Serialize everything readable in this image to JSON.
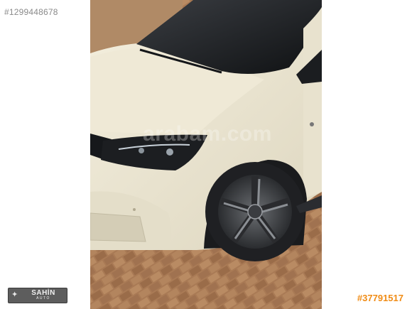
{
  "listing_id": "#1299448678",
  "photo": {
    "subject": "white-van-front-left-view",
    "watermark": "arabam.com"
  },
  "dealer_logo": {
    "name": "SAHİN",
    "sub": "AUTO"
  },
  "ad_number": "#37791517",
  "colors": {
    "listing_id": "#8a8a8a",
    "ad_number": "#f08c16",
    "car_body": "#ece6d2",
    "paving": "#a87a55"
  }
}
